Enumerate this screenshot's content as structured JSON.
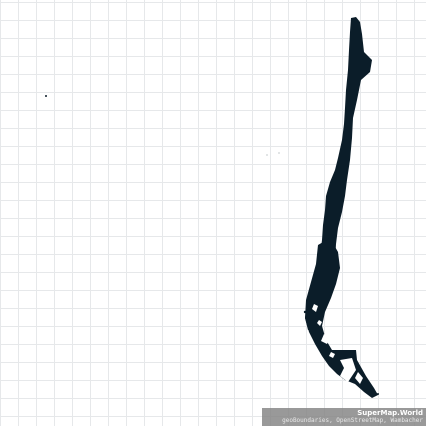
{
  "map": {
    "country": "Chile",
    "fill_color": "#0b1d29",
    "grid_color": "#e6e8ea",
    "background_color": "#ffffff"
  },
  "attribution": {
    "brand": "SuperMap.World",
    "sources": "geoBoundaries, OpenStreetMap, Wambacher"
  }
}
